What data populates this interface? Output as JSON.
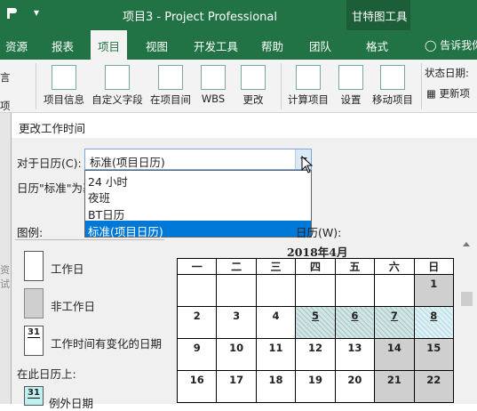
{
  "app": {
    "title": "项目3 - Project Professional",
    "context_tab_group": "甘特图工具",
    "quick_access": {
      "dropdown_label": "▾"
    }
  },
  "tabs": [
    "资源",
    "报表",
    "项目",
    "视图",
    "开发工具",
    "帮助",
    "团队",
    "格式"
  ],
  "active_tab": "项目",
  "tell_me": "告诉我你",
  "ribbon": {
    "buttons": [
      "项目信息",
      "自定义字段",
      "在项目间",
      "WBS",
      "更改",
      "计算项目",
      "设置",
      "移动项目"
    ],
    "left_fragments": [
      "言",
      "项"
    ],
    "status_date_label": "状态日期:",
    "update_project_label": "更新项"
  },
  "dialog": {
    "title": "更改工作时间",
    "for_calendar_label": "对于日历(C):",
    "calendar_value": "标准(项目日历)",
    "calendar_options": [
      "24 小时",
      "夜班",
      "BT日历",
      "标准(项目日历)"
    ],
    "selected_option_index": 3,
    "calendar_desc": "日历\"标准\"为基",
    "legend_title": "图例:",
    "click_day_label": "日历(W):",
    "legend_items": [
      "工作日",
      "非工作日",
      "工作时间有变化的日期"
    ],
    "legend_num": "31",
    "on_this_calendar": "在此日历上:",
    "exception_label": "例外日期",
    "side_fragments": [
      "资",
      "试"
    ],
    "colors": {
      "accent": "#217346",
      "selection": "#0078d7",
      "nonwork": "#cfcfcf"
    }
  },
  "calendar": {
    "month_title": "2018年4月",
    "weekday_headers": [
      "一",
      "二",
      "三",
      "四",
      "五",
      "六",
      "日"
    ],
    "weeks": [
      [
        "",
        "",
        "",
        "",
        "",
        "",
        "1"
      ],
      [
        "2",
        "3",
        "4",
        "5",
        "6",
        "7",
        "8"
      ],
      [
        "9",
        "10",
        "11",
        "12",
        "13",
        "14",
        "15"
      ],
      [
        "16",
        "17",
        "18",
        "19",
        "20",
        "21",
        "22"
      ]
    ],
    "nonwork_days": [
      "1",
      "14",
      "15",
      "21",
      "22"
    ],
    "exception_days": [
      "5",
      "6",
      "7",
      "8"
    ]
  }
}
